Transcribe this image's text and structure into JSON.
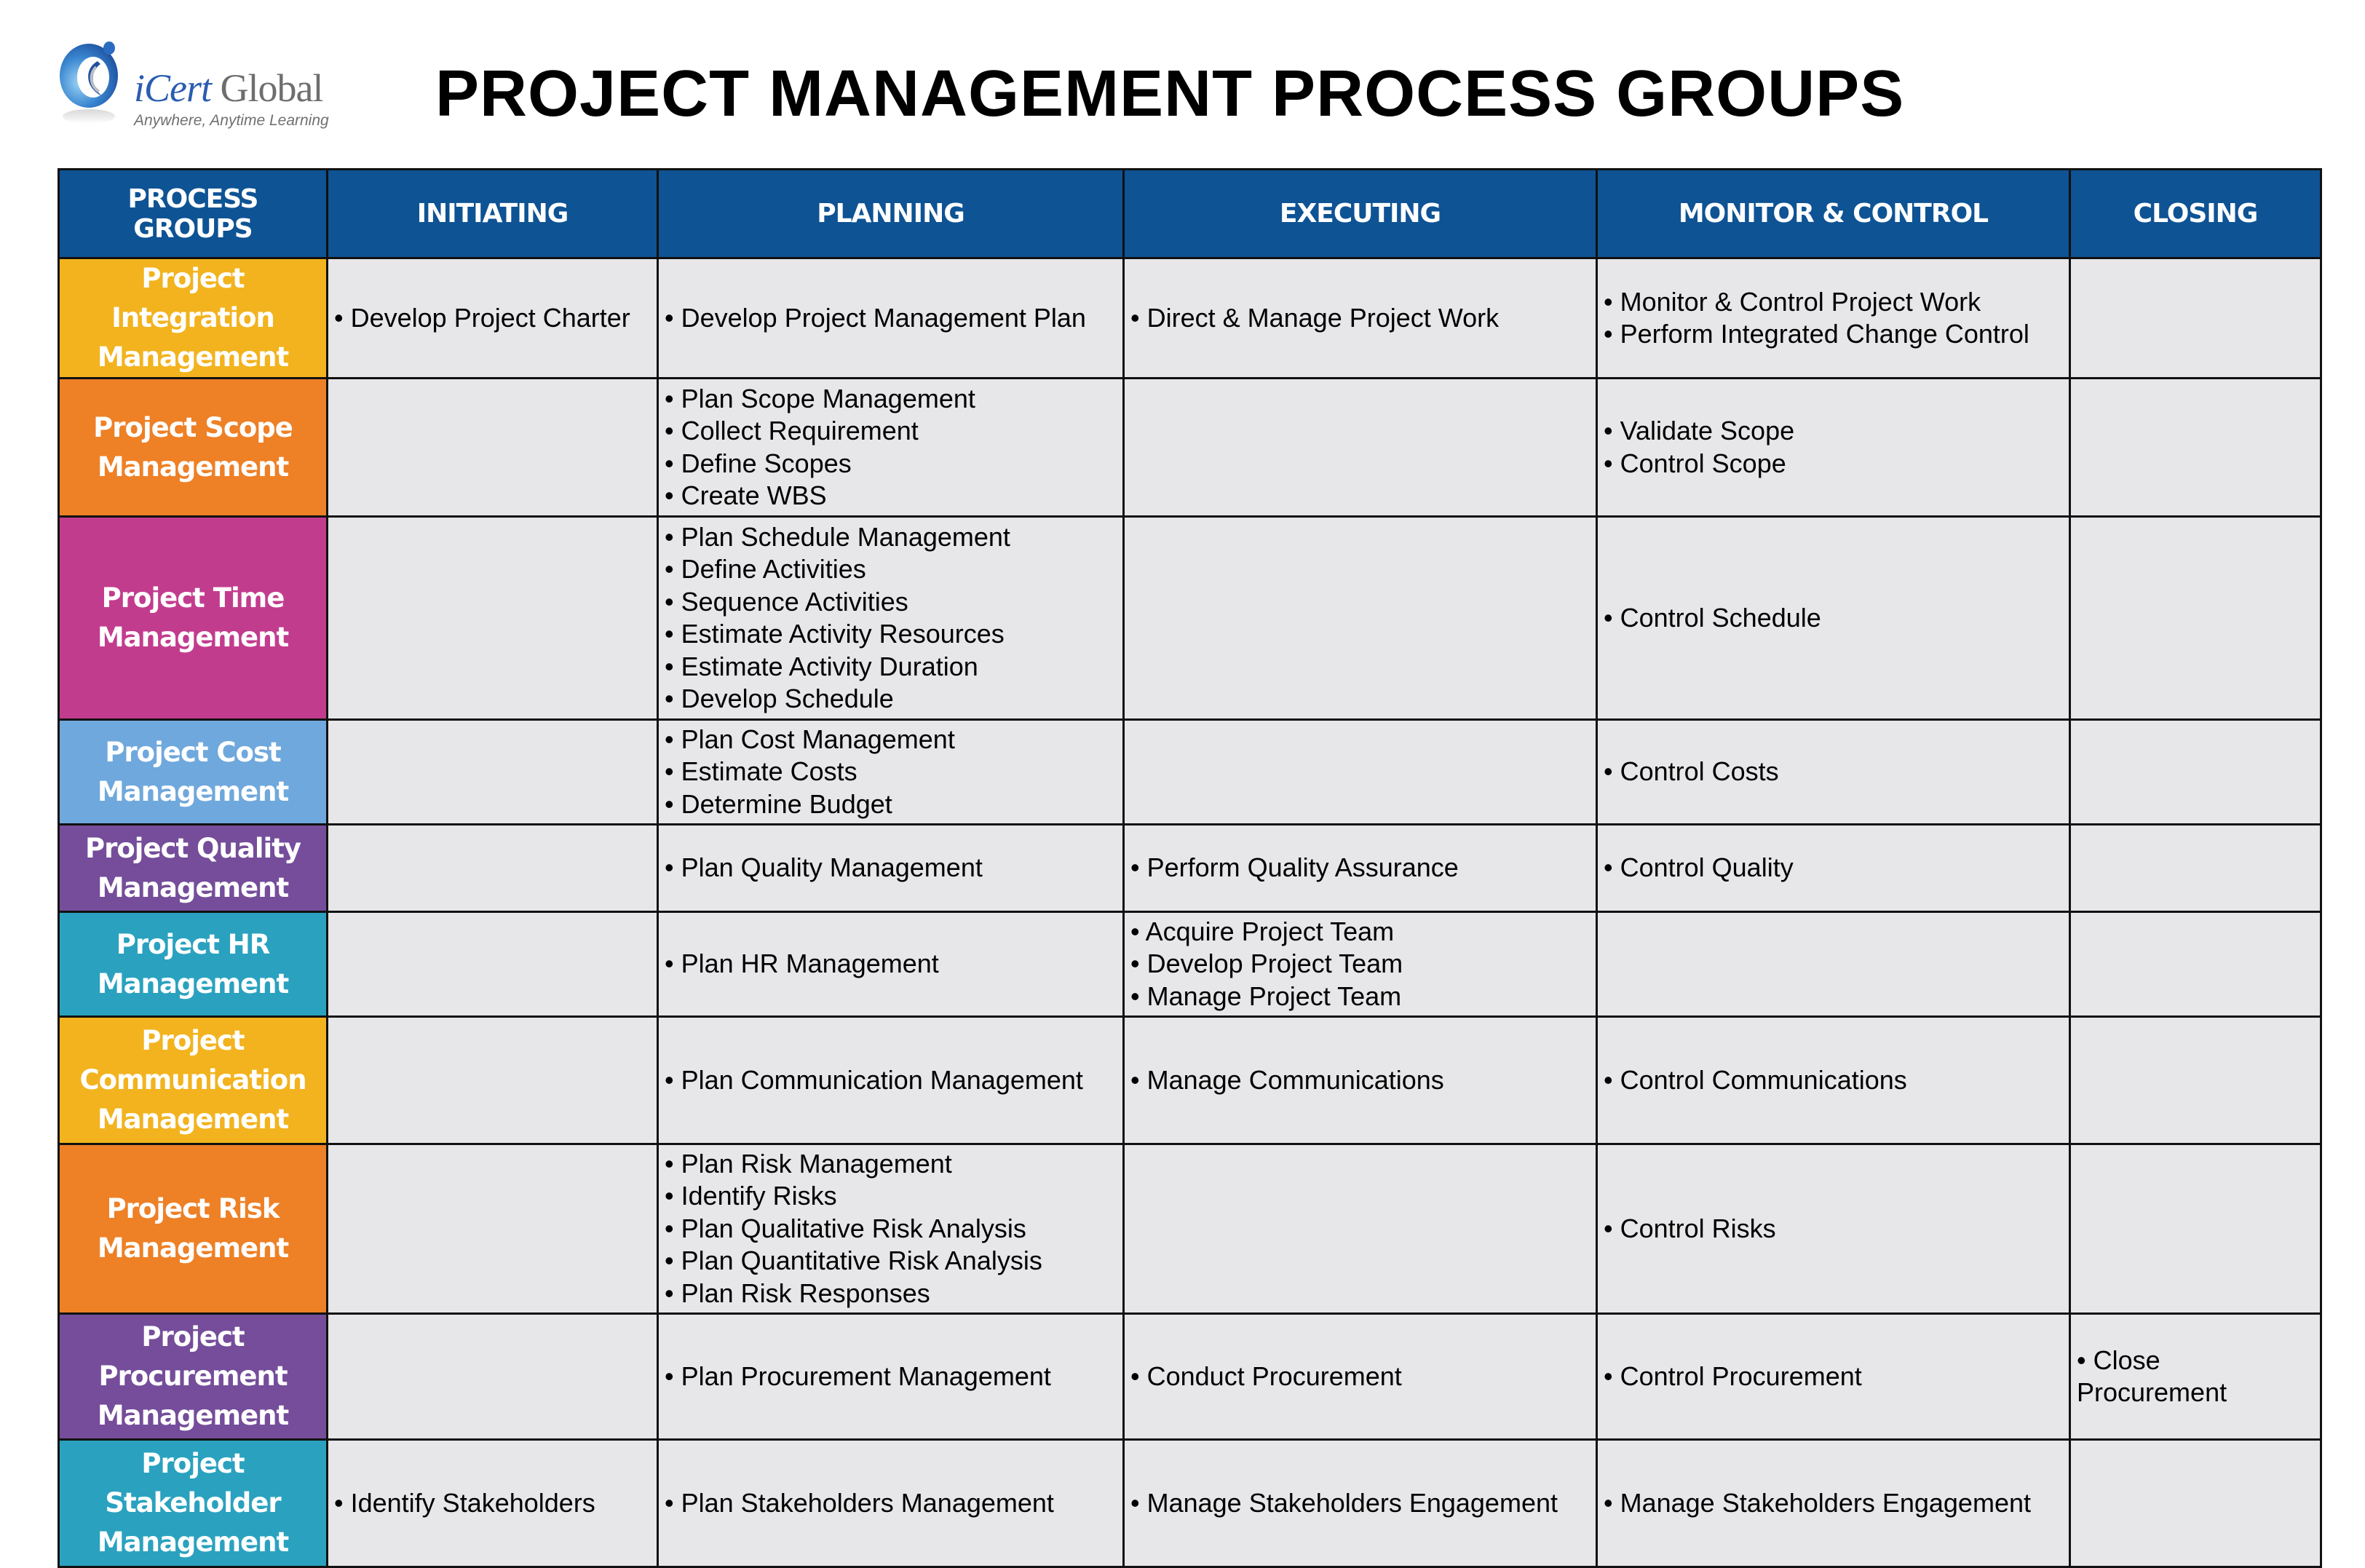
{
  "logo": {
    "icon": "icert-global-logo-icon",
    "name_prefix": "iCert",
    "name_suffix": " Global",
    "tagline": "Anywhere, Anytime Learning"
  },
  "title": "PROJECT MANAGEMENT PROCESS GROUPS",
  "colors": {
    "header_bg": "#0e5394",
    "cell_bg": "#e7e7e9"
  },
  "table": {
    "headers": [
      "PROCESS GROUPS",
      "INITIATING",
      "PLANNING",
      "EXECUTING",
      "MONITOR & CONTROL",
      "CLOSING"
    ],
    "rows": [
      {
        "label": "Project Integration Management",
        "color": "#f2b31e",
        "initiating": [
          "Develop Project Charter"
        ],
        "planning": [
          "Develop Project Management Plan"
        ],
        "executing": [
          "Direct & Manage Project Work"
        ],
        "monitor": [
          "Monitor & Control Project Work",
          "Perform Integrated Change Control"
        ],
        "closing": []
      },
      {
        "label": "Project Scope Management",
        "color": "#ee8026",
        "initiating": [],
        "planning": [
          "Plan Scope Management",
          "Collect Requirement",
          "Define Scopes",
          "Create WBS"
        ],
        "executing": [],
        "monitor": [
          "Validate Scope",
          "Control Scope"
        ],
        "closing": []
      },
      {
        "label": "Project Time Management",
        "color": "#c23c8e",
        "initiating": [],
        "planning": [
          "Plan Schedule Management",
          "Define Activities",
          "Sequence Activities",
          "Estimate Activity Resources",
          "Estimate Activity Duration",
          "Develop Schedule"
        ],
        "executing": [],
        "monitor": [
          "Control Schedule"
        ],
        "closing": []
      },
      {
        "label": "Project Cost Management",
        "color": "#6fa8dc",
        "initiating": [],
        "planning": [
          "Plan Cost Management",
          "Estimate Costs",
          "Determine Budget"
        ],
        "executing": [],
        "monitor": [
          "Control Costs"
        ],
        "closing": []
      },
      {
        "label": "Project Quality Management",
        "color": "#754d9a",
        "initiating": [],
        "planning": [
          "Plan Quality Management"
        ],
        "executing": [
          "Perform Quality Assurance"
        ],
        "monitor": [
          "Control Quality"
        ],
        "closing": []
      },
      {
        "label": "Project HR Management",
        "color": "#2aa2bf",
        "initiating": [],
        "planning": [
          "Plan HR Management"
        ],
        "executing": [
          "Acquire Project Team",
          "Develop Project Team",
          "Manage Project Team"
        ],
        "monitor": [],
        "closing": []
      },
      {
        "label": "Project Communication Management",
        "color": "#f2b31e",
        "initiating": [],
        "planning": [
          "Plan Communication Management"
        ],
        "executing": [
          "Manage Communications"
        ],
        "monitor": [
          "Control Communications"
        ],
        "closing": []
      },
      {
        "label": "Project Risk Management",
        "color": "#ee8026",
        "initiating": [],
        "planning": [
          "Plan Risk Management",
          "Identify Risks",
          "Plan Qualitative Risk Analysis",
          "Plan Quantitative Risk Analysis",
          "Plan Risk Responses"
        ],
        "executing": [],
        "monitor": [
          "Control Risks"
        ],
        "closing": []
      },
      {
        "label": "Project Procurement Management",
        "color": "#754d9a",
        "initiating": [],
        "planning": [
          "Plan Procurement Management"
        ],
        "executing": [
          "Conduct Procurement"
        ],
        "monitor": [
          "Control Procurement"
        ],
        "closing": [
          "Close Procurement"
        ]
      },
      {
        "label": "Project Stakeholder Management",
        "color": "#2aa2bf",
        "initiating": [
          "Identify Stakeholders"
        ],
        "planning": [
          "Plan Stakeholders Management"
        ],
        "executing": [
          "Manage Stakeholders Engagement"
        ],
        "monitor": [
          "Manage Stakeholders Engagement"
        ],
        "closing": []
      }
    ]
  }
}
